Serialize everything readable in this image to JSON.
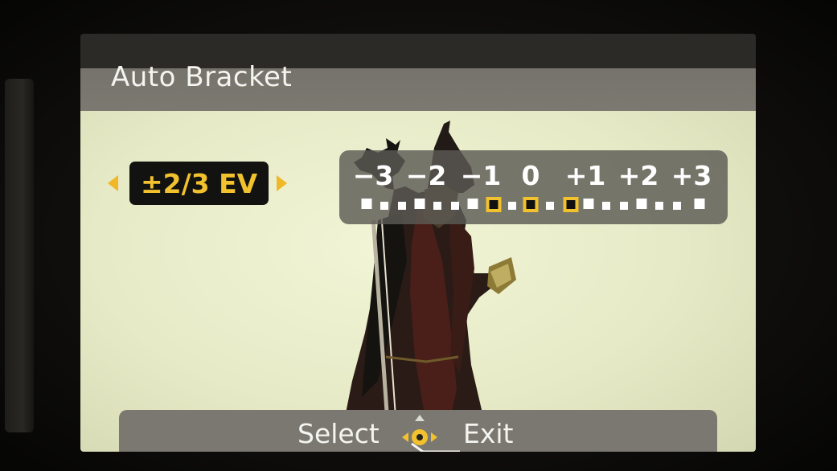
{
  "screen": {
    "title": "Auto Bracket"
  },
  "ev_control": {
    "value": "±2/3 EV",
    "left_arrow_icon": "triangle-left-icon",
    "right_arrow_icon": "triangle-right-icon"
  },
  "ev_scale": {
    "labels": [
      "−3",
      "−2",
      "−1",
      "0",
      "+1",
      "+2",
      "+3"
    ],
    "bracket_steps_selected": [
      "−2/3",
      "0",
      "+2/3"
    ],
    "step_size": "1/3 EV"
  },
  "footer": {
    "select_label": "Select",
    "nav_icon": "dpad-cross-icon",
    "exit_icon": "return-arrow-icon",
    "exit_label": "Exit"
  },
  "colors": {
    "accent": "#f2c12e",
    "panel": "#5c5a54",
    "text": "#ffffff"
  }
}
